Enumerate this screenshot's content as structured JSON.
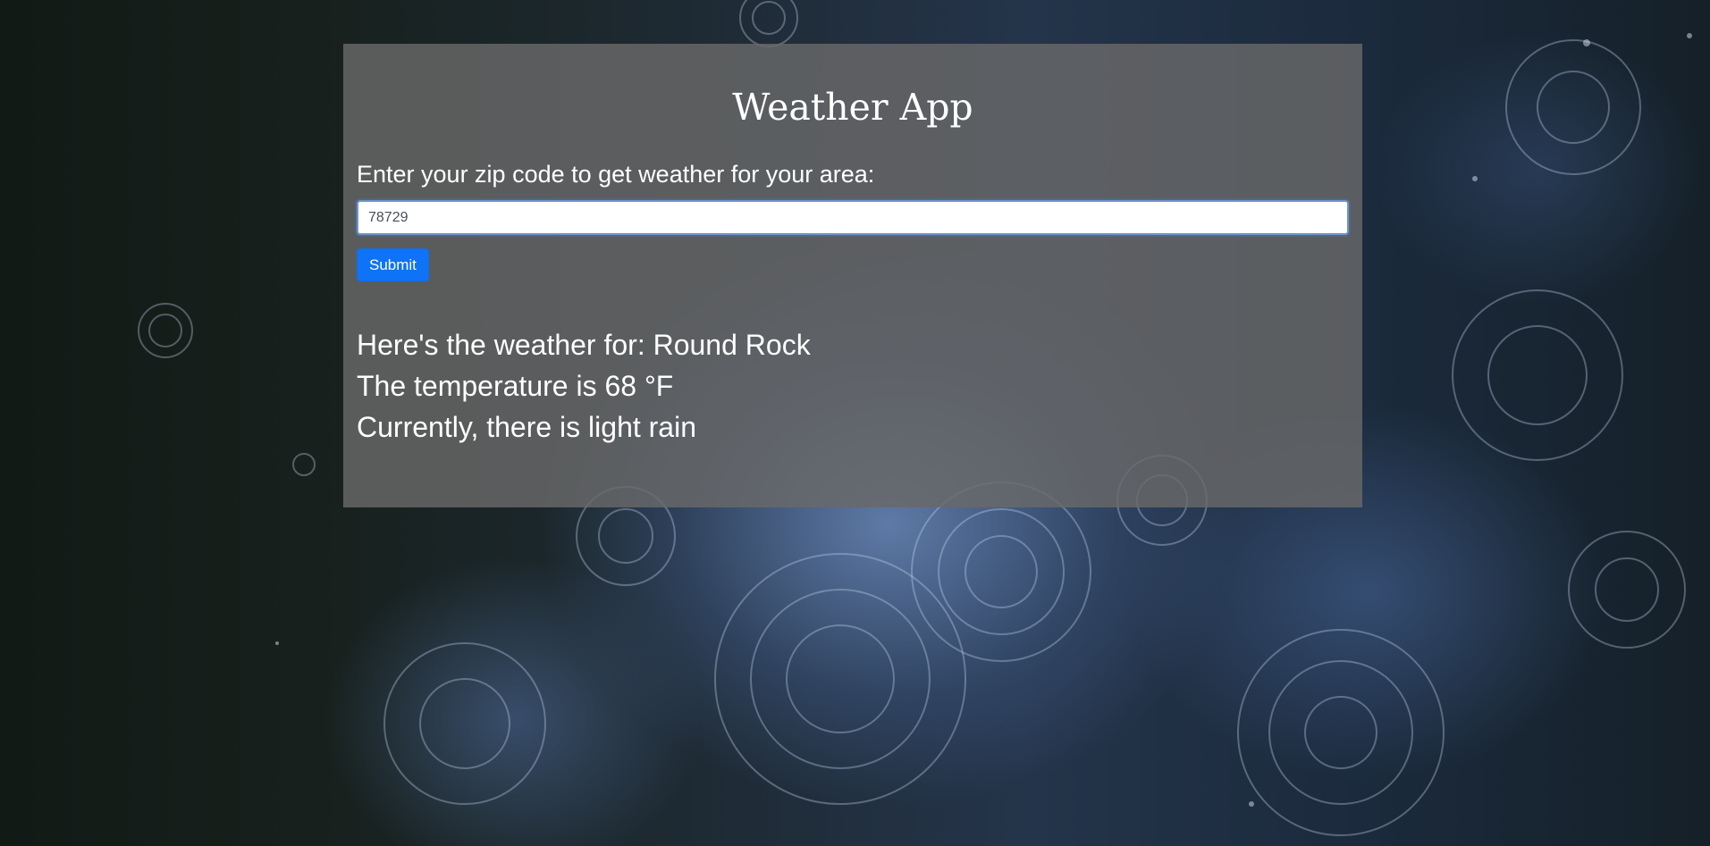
{
  "app": {
    "title": "Weather App"
  },
  "form": {
    "prompt": "Enter your zip code to get weather for your area:",
    "zip_value": "78729",
    "submit_label": "Submit"
  },
  "results": {
    "location_line": "Here's the weather for: Round Rock",
    "temperature_line": "The temperature is 68 °F",
    "conditions_line": "Currently, there is light rain"
  },
  "colors": {
    "panel_bg": "#696969",
    "button_accent": "#0e73f6",
    "text": "#ffffff"
  }
}
